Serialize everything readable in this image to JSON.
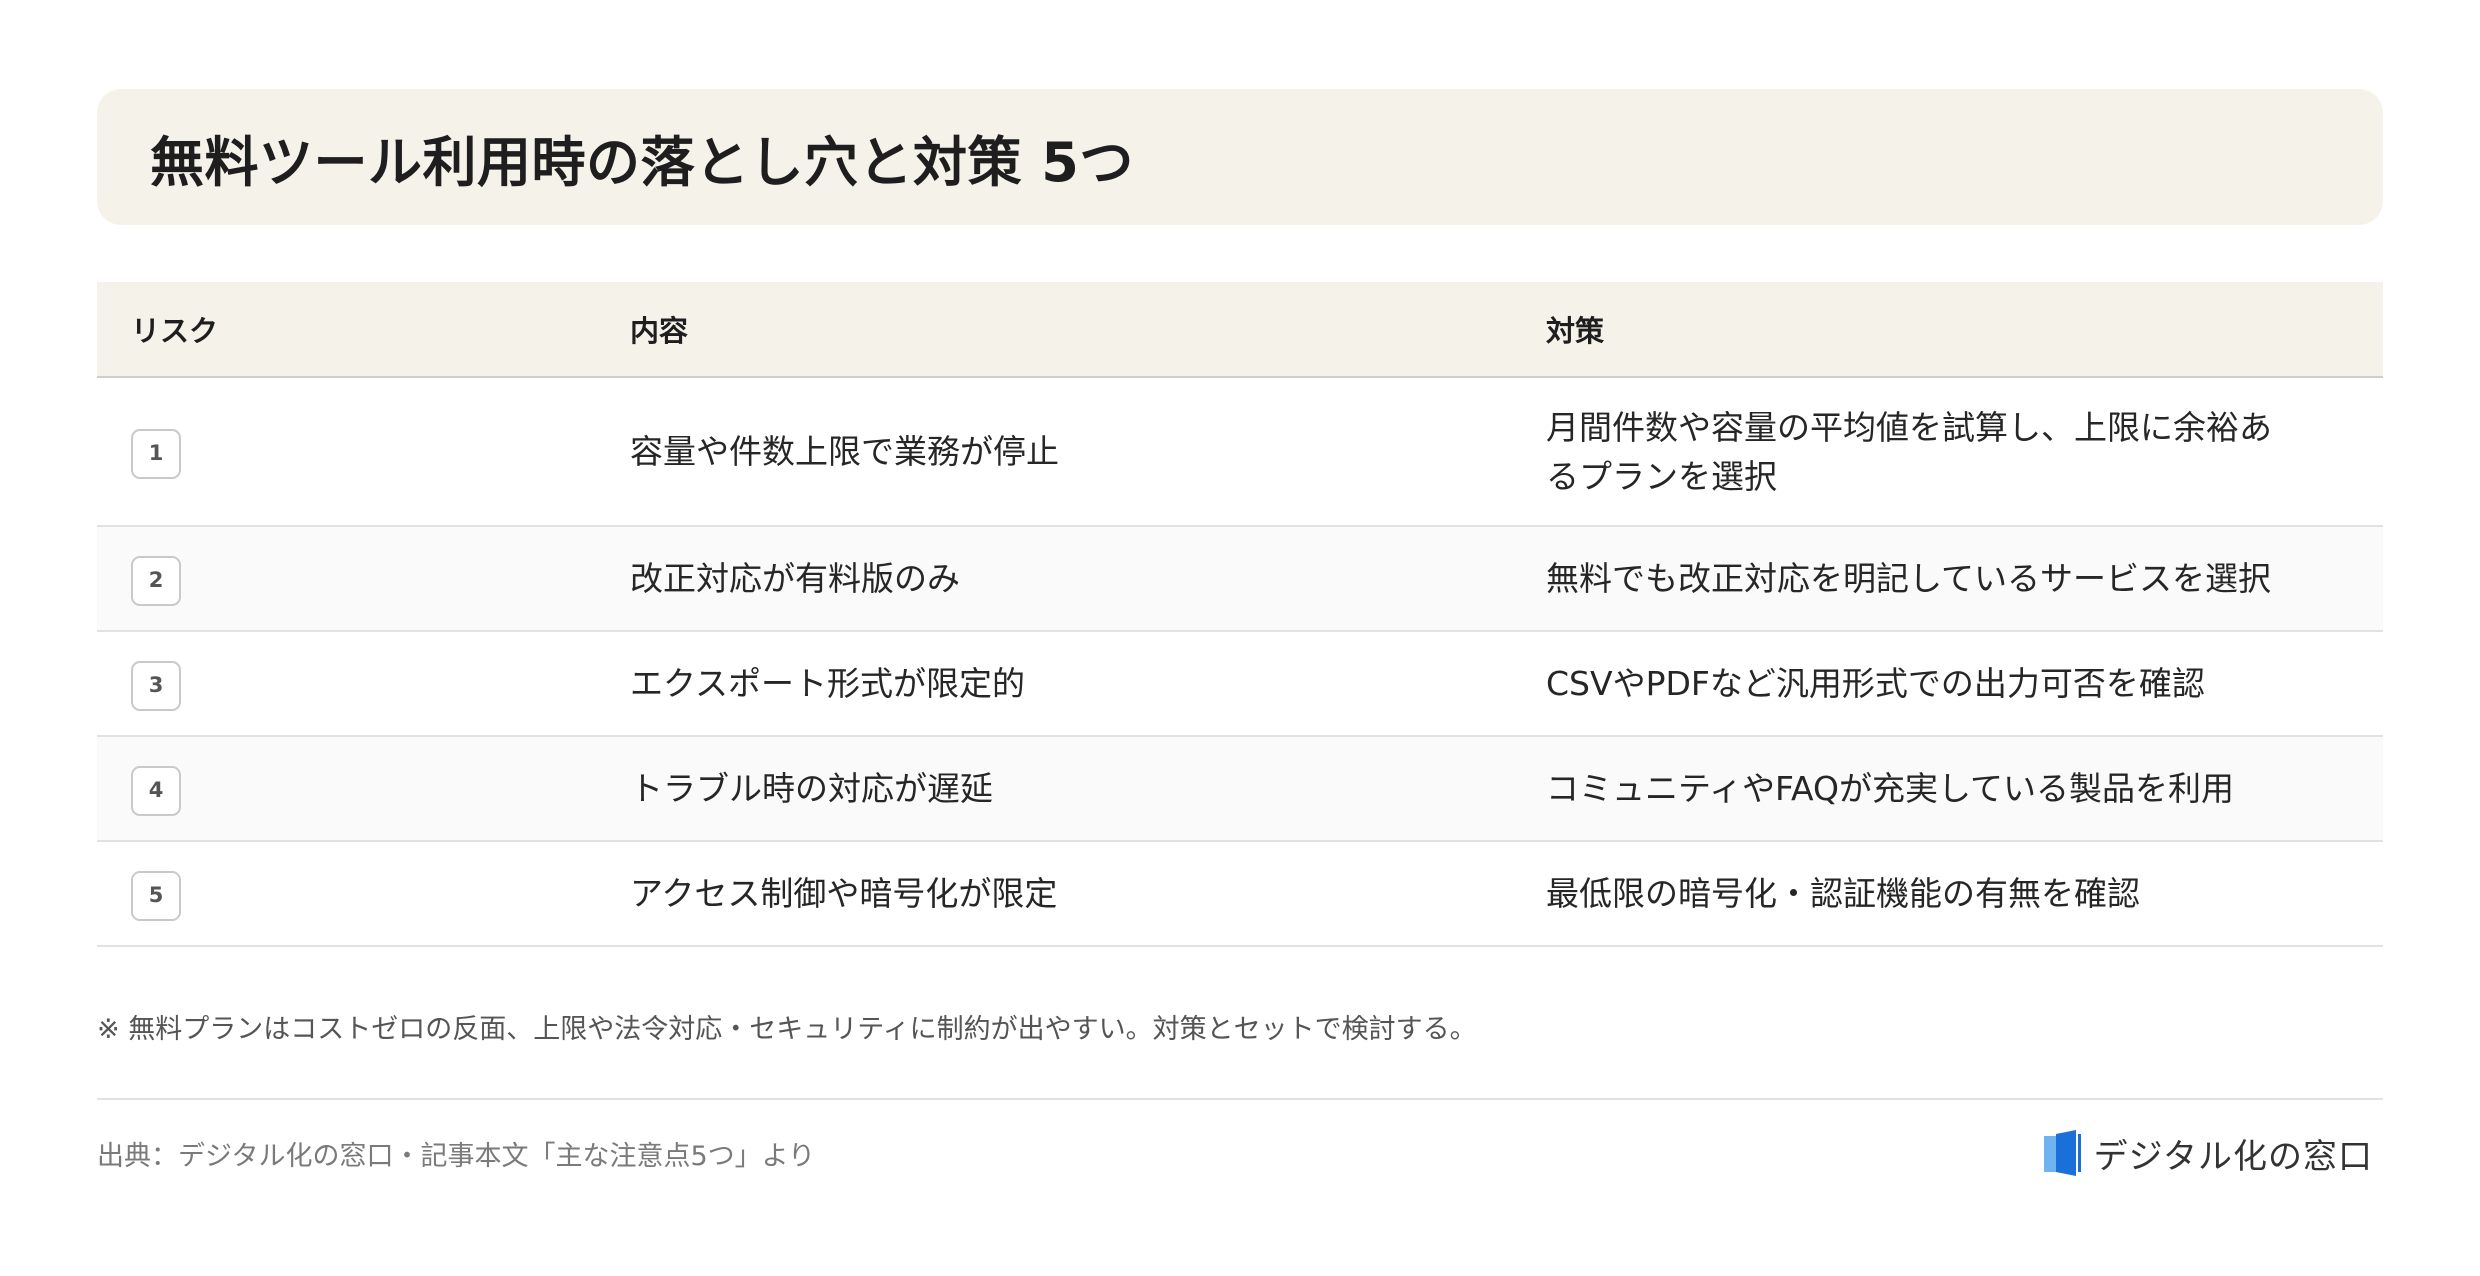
{
  "title": "無料ツール利用時の落とし穴と対策 5つ",
  "table": {
    "headers": [
      "リスク",
      "内容",
      "対策"
    ],
    "rows": [
      {
        "num": "1",
        "content": "容量や件数上限で業務が停止",
        "countermeasure": "月間件数や容量の平均値を試算し、上限に余裕あるプランを選択"
      },
      {
        "num": "2",
        "content": "改正対応が有料版のみ",
        "countermeasure": "無料でも改正対応を明記しているサービスを選択"
      },
      {
        "num": "3",
        "content": "エクスポート形式が限定的",
        "countermeasure": "CSVやPDFなど汎用形式での出力可否を確認"
      },
      {
        "num": "4",
        "content": "トラブル時の対応が遅延",
        "countermeasure": "コミュニティやFAQが充実している製品を利用"
      },
      {
        "num": "5",
        "content": "アクセス制御や暗号化が限定",
        "countermeasure": "最低限の暗号化・認証機能の有無を確認"
      }
    ]
  },
  "note": "※ 無料プランはコストゼロの反面、上限や法令対応・セキュリティに制約が出やすい。対策とセットで検討する。",
  "footer": {
    "source": "出典：デジタル化の窓口・記事本文「主な注意点5つ」より",
    "brand_name": "デジタル化の窓口",
    "brand_icon": "window-logo-icon",
    "brand_color": "#1a6fd8"
  }
}
